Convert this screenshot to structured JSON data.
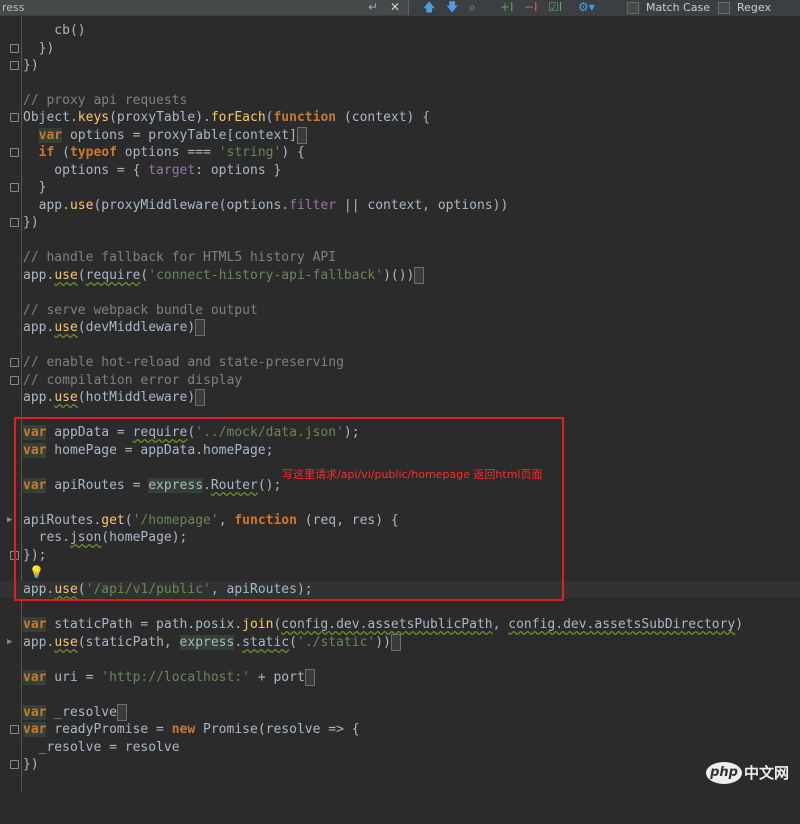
{
  "toolbar": {
    "search_value": "ress",
    "match_case_label": "Match Case",
    "regex_label": "Regex",
    "match_case_checked": false,
    "regex_checked": false
  },
  "icons": {
    "enter": "enter-icon",
    "clear": "clear-search-icon",
    "up": "up-arrow-icon",
    "down": "down-arrow-icon",
    "find_all": "find-all-icon",
    "add_occurrence": "add-occurrence-icon",
    "remove_occurrence": "remove-occurrence-icon",
    "select_all": "select-all-occurrences-icon",
    "settings": "gear-icon",
    "bulb": "lightbulb-icon"
  },
  "annotation": {
    "text": "写这里请求/api/vi/public/homepage 返回html页面",
    "color": "#e02020"
  },
  "watermark": {
    "logo": "php",
    "text": "中文网"
  },
  "colors": {
    "background": "#2b2b2b",
    "keyword": "#cc7832",
    "string": "#6a8759",
    "comment": "#808080",
    "function": "#ffc66d",
    "property": "#9876aa",
    "text": "#a9b7c6"
  },
  "code_lines": [
    "    cb()",
    "  })",
    "})",
    "",
    "// proxy api requests",
    "Object.keys(proxyTable).forEach(function (context) {",
    "  var options = proxyTable[context]",
    "  if (typeof options === 'string') {",
    "    options = { target: options }",
    "  }",
    "  app.use(proxyMiddleware(options.filter || context, options))",
    "})",
    "",
    "// handle fallback for HTML5 history API",
    "app.use(require('connect-history-api-fallback')())",
    "",
    "// serve webpack bundle output",
    "app.use(devMiddleware)",
    "",
    "// enable hot-reload and state-preserving",
    "// compilation error display",
    "app.use(hotMiddleware)",
    "",
    "var appData = require('../mock/data.json');",
    "var homePage = appData.homePage;",
    "",
    "var apiRoutes = express.Router();",
    "",
    "apiRoutes.get('/homepage', function (req, res) {",
    "  res.json(homePage);",
    "});",
    "",
    "app.use('/api/v1/public', apiRoutes);",
    "",
    "var staticPath = path.posix.join(config.dev.assetsPublicPath, config.dev.assetsSubDirectory)",
    "app.use(staticPath, express.static('./static'))",
    "",
    "var uri = 'http://localhost:' + port",
    "",
    "var _resolve",
    "var readyPromise = new Promise(resolve => {",
    "  _resolve = resolve",
    "})"
  ]
}
